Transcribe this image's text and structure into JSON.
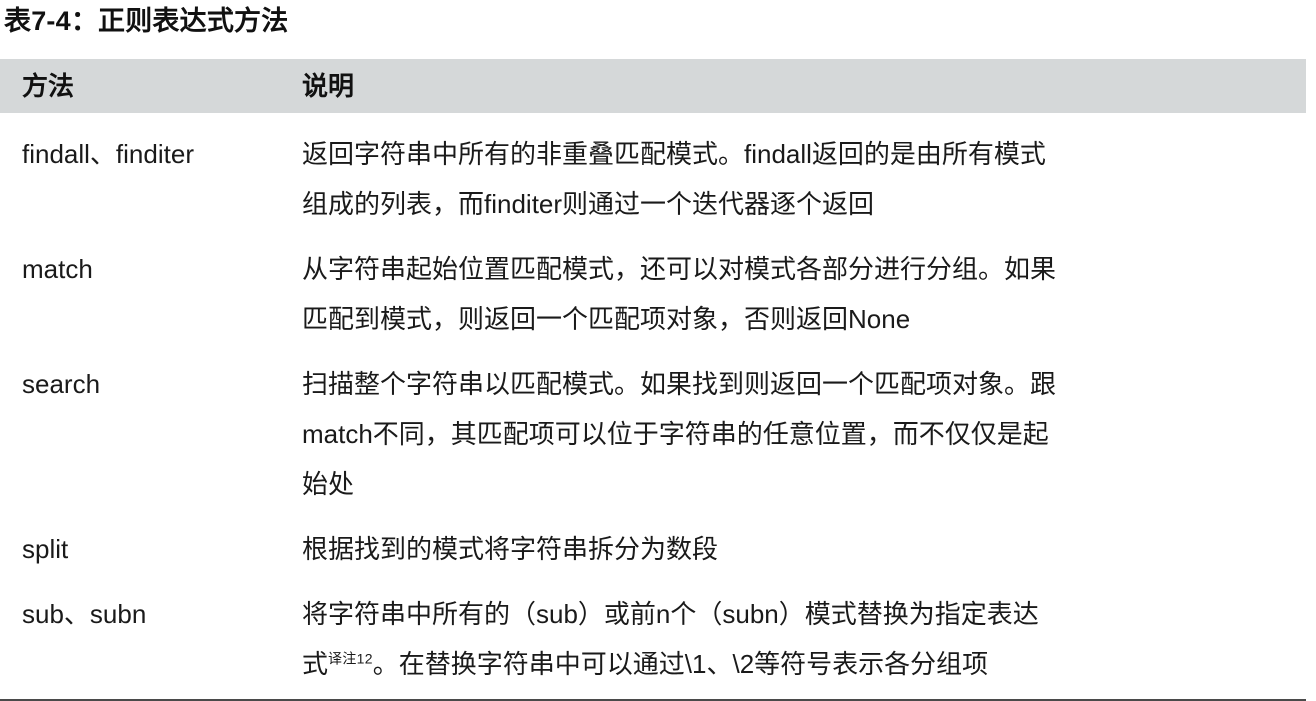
{
  "caption": "表7-4：正则表达式方法",
  "colors": {
    "page_background": "#ffffff",
    "header_band": "#d5d8d9",
    "text": "#1a1a1a",
    "bottom_rule": "#4a4a4a"
  },
  "table": {
    "headers": {
      "method": "方法",
      "description": "说明"
    },
    "rows": [
      {
        "method": "findall、finditer",
        "description_lines": [
          "返回字符串中所有的非重叠匹配模式。findall返回的是由所有模式",
          "组成的列表，而finditer则通过一个迭代器逐个返回"
        ]
      },
      {
        "method": "match",
        "description_lines": [
          "从字符串起始位置匹配模式，还可以对模式各部分进行分组。如果",
          "匹配到模式，则返回一个匹配项对象，否则返回None"
        ]
      },
      {
        "method": "search",
        "description_lines": [
          "扫描整个字符串以匹配模式。如果找到则返回一个匹配项对象。跟",
          "match不同，其匹配项可以位于字符串的任意位置，而不仅仅是起",
          "始处"
        ]
      },
      {
        "method": "split",
        "description_lines": [
          "根据找到的模式将字符串拆分为数段"
        ]
      },
      {
        "method": "sub、subn",
        "description_lines": [
          "将字符串中所有的（sub）或前n个（subn）模式替换为指定表达",
          "式"
        ],
        "footnote_marker": "译注12",
        "description_tail": "。在替换字符串中可以通过\\1、\\2等符号表示各分组项"
      }
    ]
  }
}
